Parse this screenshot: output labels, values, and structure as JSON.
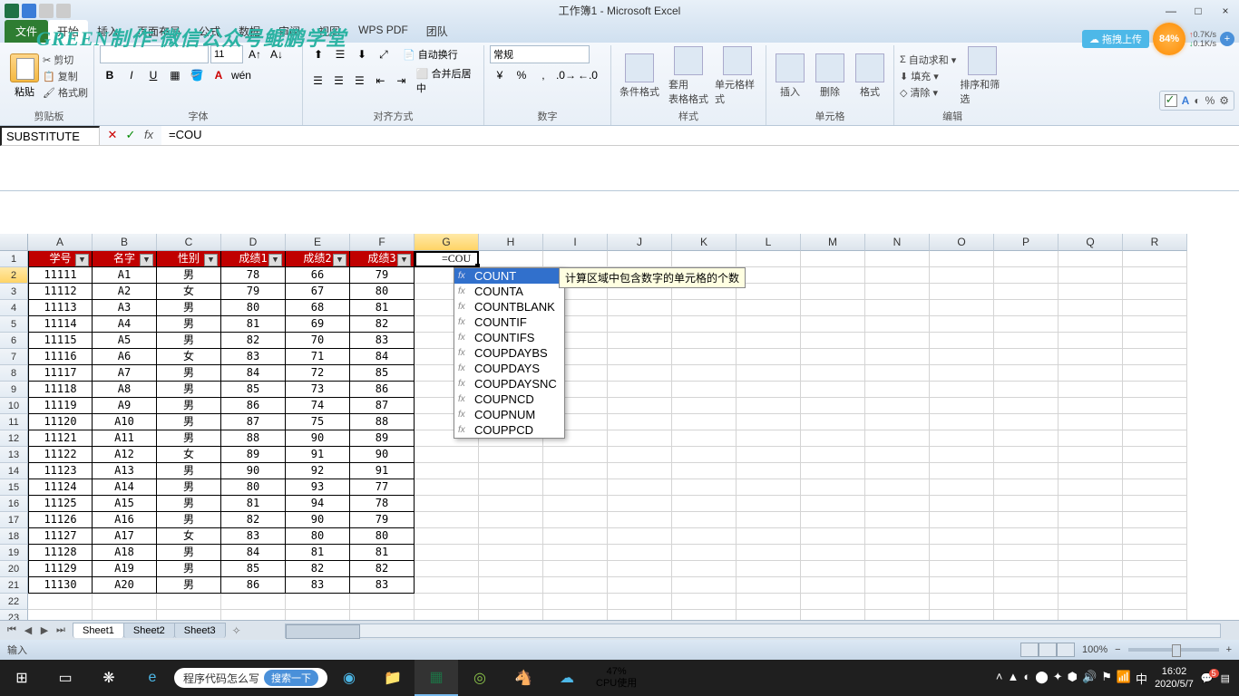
{
  "window": {
    "title": "工作簿1 - Microsoft Excel",
    "min": "—",
    "max": "□",
    "close": "×"
  },
  "watermark": "GREEN制作-微信公众号鲲鹏学堂",
  "tabs": {
    "file": "文件",
    "items": [
      "开始",
      "插入",
      "页面布局",
      "公式",
      "数据",
      "审阅",
      "视图",
      "WPS PDF",
      "团队"
    ]
  },
  "cloud": {
    "label": "拖拽上传"
  },
  "badge": {
    "percent": "84%"
  },
  "net": {
    "up": "0.7K/s",
    "down": "0.1K/s"
  },
  "ribbon": {
    "clipboard": {
      "label": "剪贴板",
      "paste": "粘贴",
      "cut": "剪切",
      "copy": "复制",
      "painter": "格式刷"
    },
    "font": {
      "label": "字体",
      "size": "11"
    },
    "align": {
      "label": "对齐方式",
      "wrap": "自动换行",
      "merge": "合并后居中"
    },
    "number": {
      "label": "数字",
      "general": "常规"
    },
    "styles": {
      "label": "样式",
      "cond": "条件格式",
      "table": "套用\n表格格式",
      "cell": "单元格样式"
    },
    "cells": {
      "label": "单元格",
      "insert": "插入",
      "delete": "删除",
      "format": "格式"
    },
    "editing": {
      "label": "编辑",
      "autosum": "自动求和",
      "fill": "填充",
      "clear": "清除",
      "sort": "排序和筛选"
    }
  },
  "float_tb": {
    "a": "A",
    "moon": "◐",
    "percent": "%",
    "gear": "⚙"
  },
  "namebox": "SUBSTITUTE",
  "formula": "=COU",
  "columns": [
    "A",
    "B",
    "C",
    "D",
    "E",
    "F",
    "G",
    "H",
    "I",
    "J",
    "K",
    "L",
    "M",
    "N",
    "O",
    "P",
    "Q",
    "R"
  ],
  "active_col": "G",
  "active_row": 2,
  "headers": [
    "学号",
    "名字",
    "性别",
    "成绩1",
    "成绩2",
    "成绩3"
  ],
  "rows": [
    [
      "11111",
      "A1",
      "男",
      "78",
      "66",
      "79"
    ],
    [
      "11112",
      "A2",
      "女",
      "79",
      "67",
      "80"
    ],
    [
      "11113",
      "A3",
      "男",
      "80",
      "68",
      "81"
    ],
    [
      "11114",
      "A4",
      "男",
      "81",
      "69",
      "82"
    ],
    [
      "11115",
      "A5",
      "男",
      "82",
      "70",
      "83"
    ],
    [
      "11116",
      "A6",
      "女",
      "83",
      "71",
      "84"
    ],
    [
      "11117",
      "A7",
      "男",
      "84",
      "72",
      "85"
    ],
    [
      "11118",
      "A8",
      "男",
      "85",
      "73",
      "86"
    ],
    [
      "11119",
      "A9",
      "男",
      "86",
      "74",
      "87"
    ],
    [
      "11120",
      "A10",
      "男",
      "87",
      "75",
      "88"
    ],
    [
      "11121",
      "A11",
      "男",
      "88",
      "90",
      "89"
    ],
    [
      "11122",
      "A12",
      "女",
      "89",
      "91",
      "90"
    ],
    [
      "11123",
      "A13",
      "男",
      "90",
      "92",
      "91"
    ],
    [
      "11124",
      "A14",
      "男",
      "80",
      "93",
      "77"
    ],
    [
      "11125",
      "A15",
      "男",
      "81",
      "94",
      "78"
    ],
    [
      "11126",
      "A16",
      "男",
      "82",
      "90",
      "79"
    ],
    [
      "11127",
      "A17",
      "女",
      "83",
      "80",
      "80"
    ],
    [
      "11128",
      "A18",
      "男",
      "84",
      "81",
      "81"
    ],
    [
      "11129",
      "A19",
      "男",
      "85",
      "82",
      "82"
    ],
    [
      "11130",
      "A20",
      "男",
      "86",
      "83",
      "83"
    ]
  ],
  "cell_input": "=COU",
  "autocomplete": {
    "items": [
      "COUNT",
      "COUNTA",
      "COUNTBLANK",
      "COUNTIF",
      "COUNTIFS",
      "COUPDAYBS",
      "COUPDAYS",
      "COUPDAYSNC",
      "COUPNCD",
      "COUPNUM",
      "COUPPCD"
    ],
    "selected": 0,
    "tooltip": "计算区域中包含数字的单元格的个数"
  },
  "sheets": {
    "list": [
      "Sheet1",
      "Sheet2",
      "Sheet3"
    ],
    "active": 0
  },
  "status": {
    "mode": "输入",
    "zoom": "100%"
  },
  "taskbar": {
    "search_text": "程序代码怎么写",
    "search_btn": "搜索一下",
    "cpu": {
      "pct": "47%",
      "label": "CPU使用"
    },
    "time": "16:02",
    "date": "2020/5/7"
  }
}
